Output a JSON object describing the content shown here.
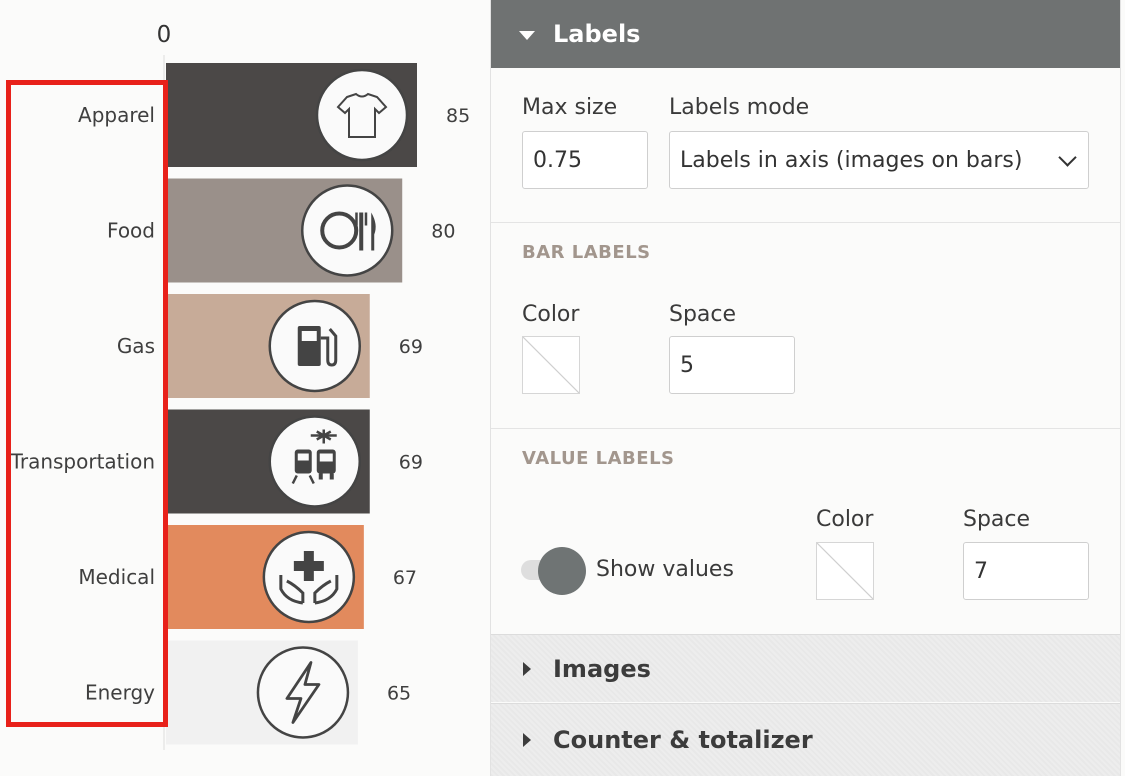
{
  "chart_data": {
    "type": "bar",
    "orientation": "horizontal",
    "axis_zero_label": "0",
    "categories": [
      "Apparel",
      "Food",
      "Gas",
      "Transportation",
      "Medical",
      "Energy"
    ],
    "values": [
      85,
      80,
      69,
      69,
      67,
      65
    ],
    "value_labels": [
      "85",
      "80",
      "69",
      "69",
      "67",
      "65"
    ],
    "colors": [
      "#4b4847",
      "#9a908a",
      "#c7ab98",
      "#4b4847",
      "#e28a5d",
      "#f1f1f1"
    ],
    "icons": [
      "tshirt-icon",
      "plate-cutlery-icon",
      "fuel-pump-icon",
      "transport-icon",
      "medical-cross-hands-icon",
      "lightning-bolt-icon"
    ]
  },
  "panel": {
    "labels_header": "Labels",
    "max_size_label": "Max size",
    "max_size_value": "0.75",
    "labels_mode_label": "Labels mode",
    "labels_mode_value": "Labels in axis (images on bars)",
    "bar_labels_title": "BAR LABELS",
    "bar_color_label": "Color",
    "bar_space_label": "Space",
    "bar_space_value": "5",
    "value_labels_title": "VALUE LABELS",
    "show_values_label": "Show values",
    "value_color_label": "Color",
    "value_space_label": "Space",
    "value_space_value": "7",
    "images_header": "Images",
    "counter_header": "Counter & totalizer"
  },
  "colors": {
    "header_bg": "#6f7272",
    "highlight": "#e8211a",
    "section_title": "#a2968d"
  }
}
